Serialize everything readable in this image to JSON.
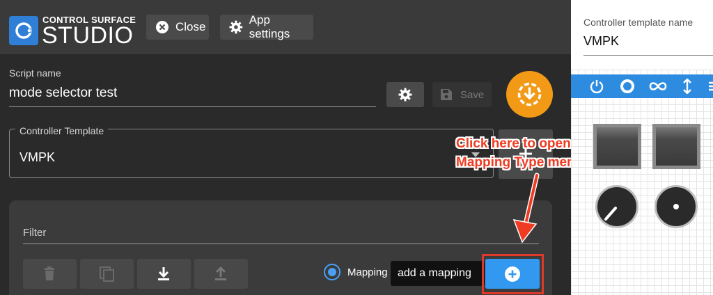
{
  "app": {
    "logo_top": "CONTROL SURFACE",
    "logo_main": "STUDIO",
    "close_label": "Close",
    "settings_label": "App settings"
  },
  "script": {
    "label": "Script name",
    "value": "mode selector test",
    "save_label": "Save"
  },
  "template": {
    "label": "Controller Template",
    "value": "VMPK"
  },
  "filter": {
    "label": "Filter"
  },
  "mappings": {
    "radio_label": "Mapping",
    "tooltip": "add a mapping"
  },
  "annotation": {
    "line1": "Click here to open the",
    "line2": "Mapping Type menu"
  },
  "right_panel": {
    "label": "Controller template name",
    "value": "VMPK"
  },
  "colors": {
    "accent_blue": "#3399f0",
    "orange": "#f29a16",
    "annotation_red": "#ef3b22"
  },
  "icons": [
    "close-circle-icon",
    "gear-icon",
    "save-icon",
    "download-circle-icon",
    "trash-icon",
    "copy-icon",
    "download-icon",
    "upload-icon",
    "plus-circle-icon",
    "power-icon",
    "circle-icon",
    "infinity-icon",
    "vertical-arrows-icon"
  ]
}
